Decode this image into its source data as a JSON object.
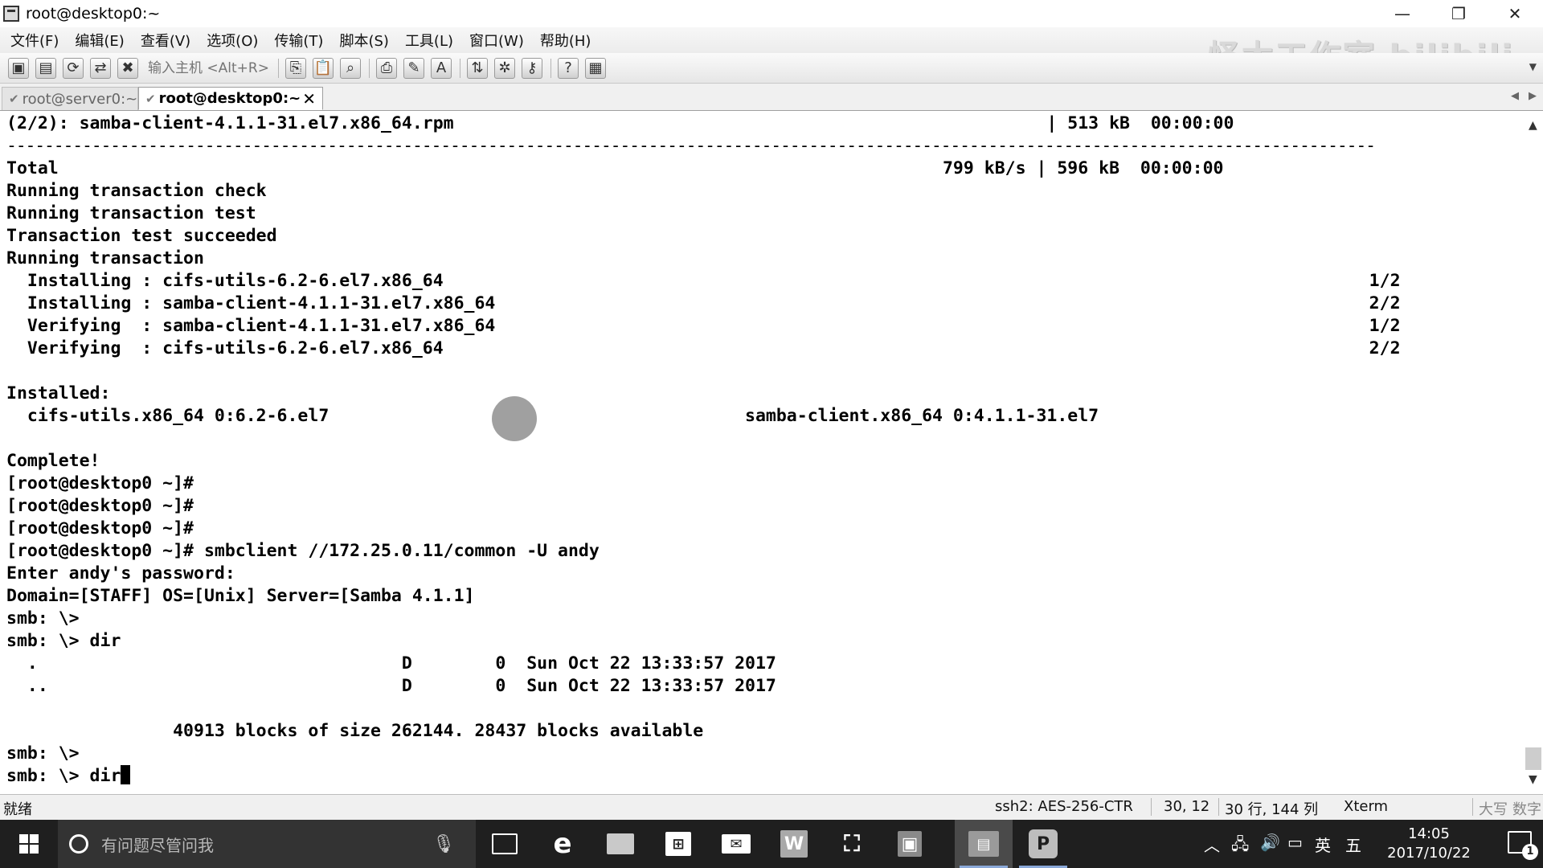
{
  "window": {
    "title": "root@desktop0:~",
    "minimize": "—",
    "maximize": "❐",
    "close": "✕"
  },
  "menu": [
    "文件(F)",
    "编辑(E)",
    "查看(V)",
    "选项(O)",
    "传输(T)",
    "脚本(S)",
    "工具(L)",
    "窗口(W)",
    "帮助(H)"
  ],
  "watermark": "怪木工作室 bilibili",
  "toolbar": {
    "host_placeholder": "输入主机 <Alt+R>"
  },
  "tabs": [
    {
      "label": "root@server0:~",
      "active": false
    },
    {
      "label": "root@desktop0:~",
      "active": true
    }
  ],
  "terminal": {
    "lines": [
      "(2/2): samba-client-4.1.1-31.el7.x86_64.rpm                                                         | 513 kB  00:00:00",
      "-------------------------------------------------------------------------------------------------------------------------------------------------",
      "Total                                                                                     799 kB/s | 596 kB  00:00:00",
      "Running transaction check",
      "Running transaction test",
      "Transaction test succeeded",
      "Running transaction",
      "  Installing : cifs-utils-6.2-6.el7.x86_64                                                                                         1/2",
      "  Installing : samba-client-4.1.1-31.el7.x86_64                                                                                    2/2",
      "  Verifying  : samba-client-4.1.1-31.el7.x86_64                                                                                    1/2",
      "  Verifying  : cifs-utils-6.2-6.el7.x86_64                                                                                         2/2",
      "",
      "Installed:",
      "  cifs-utils.x86_64 0:6.2-6.el7                                        samba-client.x86_64 0:4.1.1-31.el7",
      "",
      "Complete!",
      "[root@desktop0 ~]#",
      "[root@desktop0 ~]#",
      "[root@desktop0 ~]#",
      "[root@desktop0 ~]# smbclient //172.25.0.11/common -U andy",
      "Enter andy's password:",
      "Domain=[STAFF] OS=[Unix] Server=[Samba 4.1.1]",
      "smb: \\>",
      "smb: \\> dir",
      "  .                                   D        0  Sun Oct 22 13:33:57 2017",
      "  ..                                  D        0  Sun Oct 22 13:33:57 2017",
      "",
      "                40913 blocks of size 262144. 28437 blocks available",
      "smb: \\>",
      "smb: \\> dir"
    ]
  },
  "statusbar": {
    "ready": "就绪",
    "ssh": "ssh2: AES-256-CTR",
    "cursor_pos": "30,  12",
    "size": "30 行, 144 列",
    "term": "Xterm",
    "caps": "大写",
    "num": "数字"
  },
  "taskbar": {
    "search_placeholder": "有问题尽管问我",
    "tray_lang": "英",
    "tray_ime": "五",
    "time": "14:05",
    "date": "2017/10/22",
    "notifications": "1"
  }
}
